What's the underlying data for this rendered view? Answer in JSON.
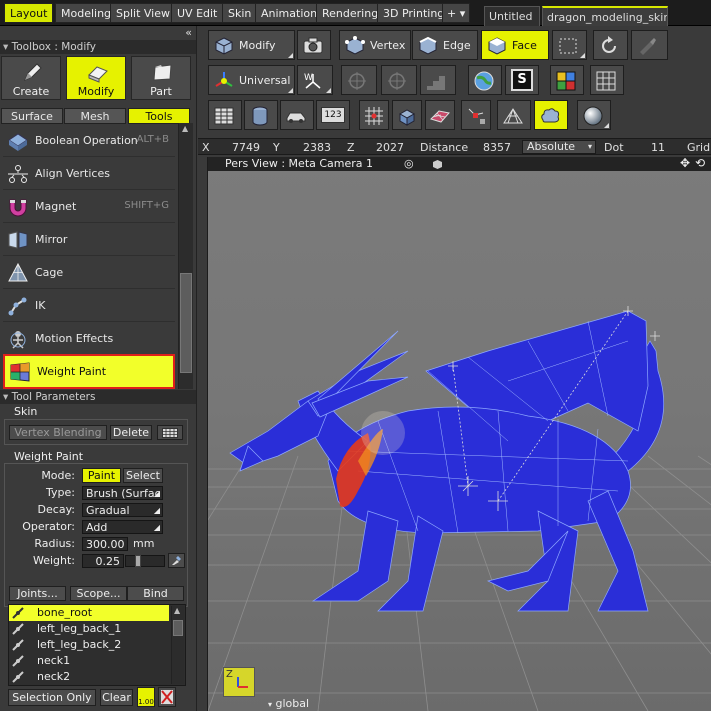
{
  "menubar": {
    "tabs": [
      {
        "label": "Layout",
        "active": true
      },
      {
        "label": "Modeling"
      },
      {
        "label": "Split View"
      },
      {
        "label": "UV Edit"
      },
      {
        "label": "Skin"
      },
      {
        "label": "Animation"
      },
      {
        "label": "Rendering"
      },
      {
        "label": "3D Printing"
      }
    ],
    "more_button": "+ ▾",
    "documents": [
      {
        "label": "Untitled"
      },
      {
        "label": "dragon_modeling_skin…",
        "active": true
      }
    ]
  },
  "left": {
    "toolbox_header": "Toolbox : Modify",
    "collapse_glyph": "«",
    "big_buttons": [
      {
        "label": "Create",
        "icon": "pen-icon"
      },
      {
        "label": "Modify",
        "icon": "eraser-icon",
        "active": true
      },
      {
        "label": "Part",
        "icon": "folder-icon"
      }
    ],
    "subtabs": [
      {
        "label": "Surface"
      },
      {
        "label": "Mesh"
      },
      {
        "label": "Tools",
        "active": true
      }
    ],
    "tools": [
      {
        "label": "Boolean Operation",
        "shortcut": "ALT+B",
        "icon": "boolean-icon"
      },
      {
        "label": "Align Vertices",
        "shortcut": "",
        "icon": "align-vertices-icon"
      },
      {
        "label": "Magnet",
        "shortcut": "SHIFT+G",
        "icon": "magnet-icon"
      },
      {
        "label": "Mirror",
        "shortcut": "",
        "icon": "mirror-icon"
      },
      {
        "label": "Cage",
        "shortcut": "",
        "icon": "cage-icon"
      },
      {
        "label": "IK",
        "shortcut": "",
        "icon": "ik-icon"
      },
      {
        "label": "Motion Effects",
        "shortcut": "",
        "icon": "motion-effects-icon"
      },
      {
        "label": "Weight Paint",
        "shortcut": "",
        "icon": "weight-paint-icon",
        "active": true
      }
    ],
    "tool_params_header": "Tool Parameters",
    "skin": {
      "label": "Skin",
      "vertex_blending": "Vertex Blending",
      "delete": "Delete"
    },
    "weight_paint": {
      "label": "Weight Paint",
      "mode_label": "Mode:",
      "mode_paint": "Paint",
      "mode_select": "Select",
      "type_label": "Type:",
      "type_value": "Brush (Surfac",
      "decay_label": "Decay:",
      "decay_value": "Gradual",
      "operator_label": "Operator:",
      "operator_value": "Add",
      "radius_label": "Radius:",
      "radius_value": "300.00",
      "radius_unit": "mm",
      "weight_label": "Weight:",
      "weight_value": "0.25",
      "weight_level": 0.25
    },
    "joint_buttons": {
      "joints": "Joints...",
      "scope": "Scope...",
      "bind": "Bind"
    },
    "joints": [
      {
        "name": "bone_root",
        "selected": true
      },
      {
        "name": "left_leg_back_1"
      },
      {
        "name": "left_leg_back_2"
      },
      {
        "name": "neck1"
      },
      {
        "name": "neck2"
      }
    ],
    "bottom": {
      "selection_only": "Selection Only",
      "clear": "Clear",
      "value_badge": "1.00"
    }
  },
  "toolbar": {
    "row1": [
      {
        "label": "Modify",
        "icon": "modify-icon"
      },
      {
        "label": "",
        "icon": "camera-icon"
      },
      {
        "label": "Vertex",
        "icon": "vertex-icon"
      },
      {
        "label": "Edge",
        "icon": "edge-icon"
      },
      {
        "label": "Face",
        "icon": "face-icon",
        "active": true
      },
      {
        "label": "",
        "icon": "rect-select-icon"
      },
      {
        "label": "",
        "icon": "rotate-icon"
      },
      {
        "label": "",
        "icon": "paint-brush-icon"
      }
    ],
    "row2": [
      {
        "label": "Universal",
        "icon": "universal-axis-icon"
      },
      {
        "label": "",
        "icon": "world-axis-icon"
      },
      {
        "label": "",
        "icon": "crosshair-icon"
      },
      {
        "label": "",
        "icon": "crosshair-icon"
      },
      {
        "label": "",
        "icon": "stairs-icon"
      },
      {
        "label": "",
        "icon": "globe-icon"
      },
      {
        "label": "S",
        "icon": "s-snap-icon"
      },
      {
        "label": "",
        "icon": "color-grid-icon"
      },
      {
        "label": "",
        "icon": "grid-icon"
      }
    ],
    "row3": [
      {
        "label": "",
        "icon": "table-icon"
      },
      {
        "label": "",
        "icon": "cylinder-icon"
      },
      {
        "label": "",
        "icon": "car-icon"
      },
      {
        "label": "123",
        "icon": "numbers-icon"
      },
      {
        "label": "",
        "icon": "vertex-grid-icon"
      },
      {
        "label": "",
        "icon": "cube-stack-icon"
      },
      {
        "label": "",
        "icon": "patterned-plane-icon"
      },
      {
        "label": "",
        "icon": "move-vertex-icon"
      },
      {
        "label": "",
        "icon": "mesh-lattice-icon"
      },
      {
        "label": "",
        "icon": "cloud-brush-icon",
        "active": true
      },
      {
        "label": "",
        "icon": "sphere-icon"
      }
    ]
  },
  "coords": {
    "x_label": "X",
    "x_value": "7749",
    "y_label": "Y",
    "y_value": "2383",
    "z_label": "Z",
    "z_value": "2027",
    "distance_label": "Distance",
    "distance_value": "8357",
    "mode": "Absolute",
    "dot_label": "Dot",
    "dot_value": "11",
    "grid_label": "Grid"
  },
  "viewport": {
    "title": "Pers View : Meta Camera 1",
    "bottom_label": "global",
    "axis_gizmo": "Z"
  },
  "colors": {
    "accent": "#e6f200",
    "mesh": "#2a2ed8",
    "highlight": "#e0201a"
  }
}
